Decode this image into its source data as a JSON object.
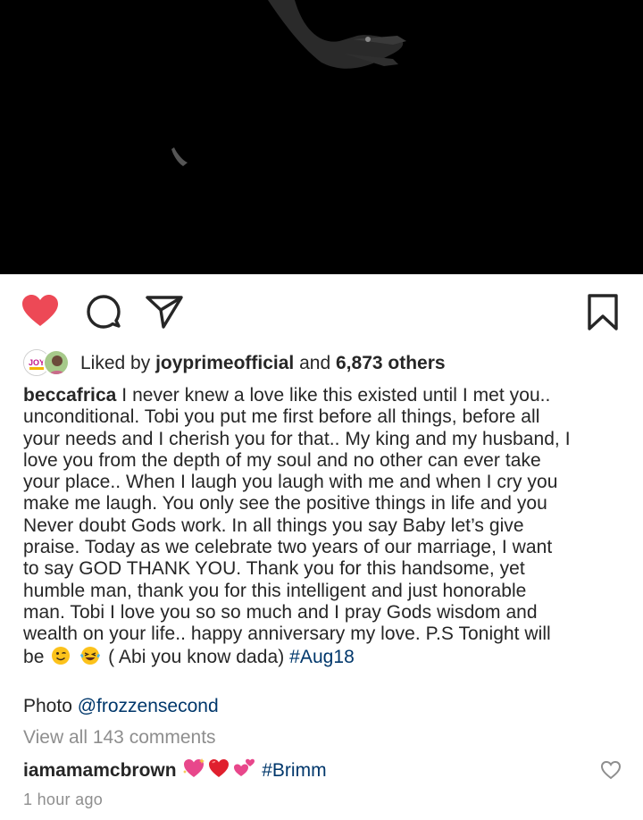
{
  "post": {
    "liked_by": {
      "prefix": "Liked by",
      "user": "joyprimeofficial",
      "joiner": "and",
      "others": "6,873 others"
    },
    "caption": {
      "username": "beccafrica",
      "lines": [
        "I never knew a love like this existed until I met you..",
        "unconditional. Tobi you put me first before all things, before all",
        "your needs and I cherish you for that.. My king and my husband, I",
        "love you from the depth of my soul and no other can ever take",
        "your place.. When I laugh you laugh with me and when I cry you",
        "make me laugh. You only see the positive things in life and you",
        "Never doubt Gods work. In all things you say Baby let’s give",
        "praise. Today as we celebrate two years of our marriage, I want",
        "to say GOD THANK YOU. Thank you for this handsome, yet",
        "humble man, thank you for this intelligent and just honorable",
        "man. Tobi I love you so so much and I pray Gods wisdom and",
        "wealth on your life.. happy anniversary my love. P.S Tonight will"
      ],
      "last_line_start": "be",
      "last_line_text": "( Abi you know dada)",
      "hashtag": "#Aug18"
    },
    "photo_credit": {
      "label": "Photo",
      "mention": "@frozzensecond"
    },
    "view_comments": "View all 143 comments",
    "top_comment": {
      "username": "iamamamcbrown",
      "hashtag": "#Brimm"
    },
    "timestamp": "1 hour ago",
    "avatar_logo_text": "JOY",
    "colors": {
      "like_red": "#ed4956",
      "link_blue": "#00376b",
      "muted_gray": "#8e8e8e",
      "text": "#262626"
    },
    "icons": [
      "heart-filled-icon",
      "comment-icon",
      "share-icon",
      "bookmark-icon",
      "heart-outline-icon"
    ]
  }
}
